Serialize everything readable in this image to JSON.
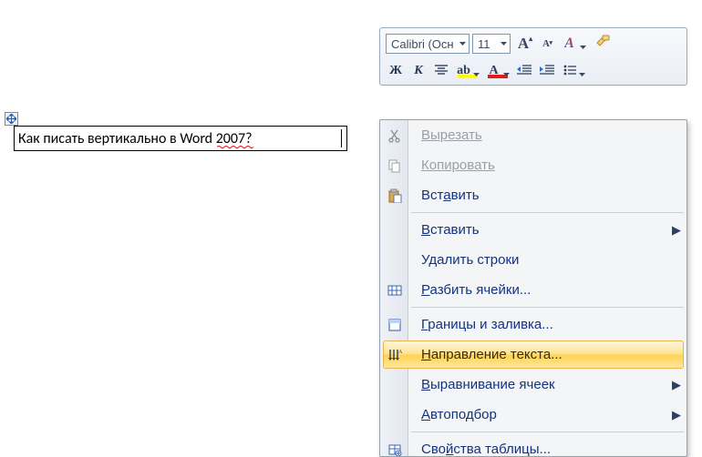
{
  "toolbar": {
    "font_name": "Calibri (Осн",
    "font_size": "11"
  },
  "cell": {
    "text": "Как писать вертикально в Word 2007?"
  },
  "menu": {
    "cut": "Вырезать",
    "copy": "Копировать",
    "paste": "Вставить",
    "paste_special": "Вставить",
    "delete_rows": "Удалить строки",
    "split_cells": "Разбить ячейки...",
    "borders": "Границы и заливка...",
    "text_dir": "Направление текста...",
    "cell_align": "Выравнивание ячеек",
    "autofit": "Автоподбор",
    "table_props": "Свойства таблицы..."
  }
}
